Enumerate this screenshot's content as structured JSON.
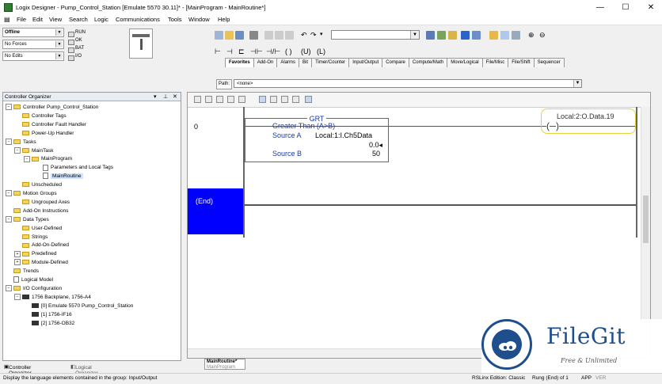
{
  "window": {
    "title": "Logix Designer - Pump_Control_Station [Emulate 5570 30.11]* - [MainProgram - MainRoutine*]",
    "minimize": "—",
    "maximize": "☐",
    "close": "✕"
  },
  "menu": [
    "File",
    "Edit",
    "View",
    "Search",
    "Logic",
    "Communications",
    "Tools",
    "Window",
    "Help"
  ],
  "controller_status": {
    "mode": "Offline",
    "forces": "No Forces",
    "edits": "No Edits",
    "leds": [
      "RUN",
      "OK",
      "BAT",
      "I/O"
    ]
  },
  "instruction_tabs": [
    "Favorites",
    "Add-On",
    "Alarms",
    "Bit",
    "Timer/Counter",
    "Input/Output",
    "Compare",
    "Compute/Math",
    "Move/Logical",
    "File/Misc",
    "File/Shift",
    "Sequencer"
  ],
  "path": {
    "label": "Path:",
    "value": "<none>"
  },
  "organizer": {
    "title": "Controller Organizer",
    "items": [
      {
        "label": "Controller Pump_Control_Station",
        "icon": "folder-icon",
        "level": 0
      },
      {
        "label": "Controller Tags",
        "icon": "folder-icon",
        "level": 1
      },
      {
        "label": "Controller Fault Handler",
        "icon": "folder-icon",
        "level": 1
      },
      {
        "label": "Power-Up Handler",
        "icon": "folder-icon",
        "level": 1
      },
      {
        "label": "Tasks",
        "icon": "folder-icon",
        "level": 0
      },
      {
        "label": "MainTask",
        "icon": "folder-icon",
        "level": 1
      },
      {
        "label": "MainProgram",
        "icon": "folder-icon",
        "level": 2
      },
      {
        "label": "Parameters and Local Tags",
        "icon": "doc-icon",
        "level": 3
      },
      {
        "label": "MainRoutine",
        "icon": "doc-icon",
        "level": 3,
        "selected": true
      },
      {
        "label": "Unscheduled",
        "icon": "folder-icon",
        "level": 1
      },
      {
        "label": "Motion Groups",
        "icon": "folder-icon",
        "level": 0
      },
      {
        "label": "Ungrouped Axes",
        "icon": "folder-icon",
        "level": 1
      },
      {
        "label": "Add-On Instructions",
        "icon": "folder-icon",
        "level": 0
      },
      {
        "label": "Data Types",
        "icon": "folder-icon",
        "level": 0
      },
      {
        "label": "User-Defined",
        "icon": "folder-icon",
        "level": 1
      },
      {
        "label": "Strings",
        "icon": "folder-icon",
        "level": 1
      },
      {
        "label": "Add-On-Defined",
        "icon": "folder-icon",
        "level": 1
      },
      {
        "label": "Predefined",
        "icon": "folder-icon",
        "level": 1
      },
      {
        "label": "Module-Defined",
        "icon": "folder-icon",
        "level": 1
      },
      {
        "label": "Trends",
        "icon": "folder-icon",
        "level": 0
      },
      {
        "label": "Logical Model",
        "icon": "doc-icon",
        "level": 0
      },
      {
        "label": "I/O Configuration",
        "icon": "folder-icon",
        "level": 0
      },
      {
        "label": "1756 Backplane, 1756-A4",
        "icon": "backplane-icon",
        "level": 1
      },
      {
        "label": "[0] Emulate 5570 Pump_Control_Station",
        "icon": "module-icon",
        "level": 2
      },
      {
        "label": "[1] 1756-IF16",
        "icon": "module-icon",
        "level": 2
      },
      {
        "label": "[2] 1756-OB32",
        "icon": "module-icon",
        "level": 2
      }
    ],
    "bottom_tabs": [
      "Controller Organizer",
      "Logical Organizer"
    ]
  },
  "ladder": {
    "rung0_number": "0",
    "instruction": "GRT",
    "description": "Greater Than (A>B)",
    "source_a_label": "Source A",
    "source_a_tag": "Local:1:I.Ch5Data",
    "source_a_value": "0.0",
    "source_b_label": "Source B",
    "source_b_value": "50",
    "coil_tag": "Local:2:O.Data.19",
    "end_label": "(End)"
  },
  "routine_tab": {
    "name": "MainRoutine*",
    "sub": "MainProgram"
  },
  "status_bar": {
    "hint": "Display the language elements contained in the group: Input/Output",
    "edition": "RSLinx Edition: Classic",
    "rung": "Rung (End) of 1",
    "app": "APP",
    "ver": "VER"
  },
  "watermark": {
    "brand": "FileGit",
    "tagline": "Free & Unlimited"
  }
}
